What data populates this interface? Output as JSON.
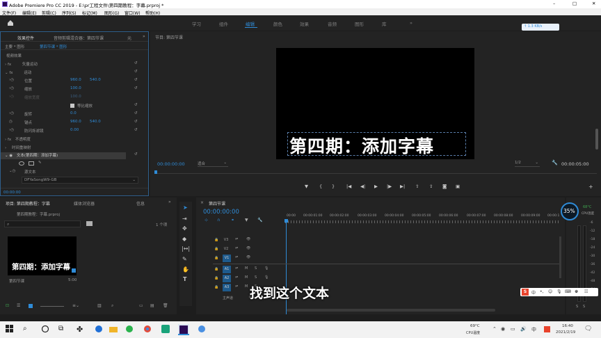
{
  "titlebar": {
    "title": "Adobe Premiere Pro CC 2019 - E:\\pr工程文件\\第四期教程：字幕.prproj *",
    "minimize": "–",
    "maximize": "□",
    "close": "✕"
  },
  "menu": [
    "文件(F)",
    "编辑(E)",
    "剪辑(C)",
    "序列(S)",
    "标记(M)",
    "图形(G)",
    "窗口(W)",
    "帮助(H)"
  ],
  "workspaces": [
    "学习",
    "组件",
    "编辑",
    "颜色",
    "效果",
    "音频",
    "图形",
    "库"
  ],
  "workspace_active": "编辑",
  "netspeed": "↑ 1.3 KB/s",
  "effect_controls": {
    "tabs": [
      "效果控件",
      "音频剪辑混合器：第四节课",
      "元"
    ],
    "breadcrumb_main": "主要 * 图形",
    "breadcrumb_seq": "第四节课 * 图形",
    "video_section": "视频效果",
    "rows": [
      {
        "label": "矢量运动"
      },
      {
        "label": "运动"
      },
      {
        "label": "位置",
        "v1": "960.0",
        "v2": "540.0"
      },
      {
        "label": "缩放",
        "v1": "100.0"
      },
      {
        "label": "缩放宽度",
        "v1": "100.0"
      },
      {
        "label": "等比缩放"
      },
      {
        "label": "旋转",
        "v1": "0.0"
      },
      {
        "label": "锚点",
        "v1": "960.0",
        "v2": "540.0"
      },
      {
        "label": "防闪烁滤镜",
        "v1": "0.00"
      },
      {
        "label": "不透明度"
      },
      {
        "label": "时间重映射"
      },
      {
        "label": "文本(第四期：添加字幕)"
      },
      {
        "label": "源文本"
      }
    ],
    "font": "DFYaSongW9-GB",
    "timecode": "00:00:00"
  },
  "program": {
    "title": "节目: 第四节课",
    "caption": "第四期：添加字幕",
    "timecode": "00:00:00:00",
    "fit": "适合",
    "ratio": "1/2",
    "duration": "00:00:05:00"
  },
  "project": {
    "tabs": [
      "项目: 第四期教程：字幕",
      "媒体浏览器",
      "信息"
    ],
    "file": "第四期教程：字幕.prproj",
    "count": "1 个项",
    "thumb_caption": "第四期：添加字幕",
    "item_name": "第四节课",
    "item_dur": "5:00"
  },
  "timeline": {
    "tab": "第四节课",
    "timecode": "00:00:00:00",
    "ruler": [
      "00:00",
      "00:00:01:00",
      "00:00:02:00",
      "00:00:03:00",
      "00:00:04:00",
      "00:00:05:00",
      "00:00:06:00",
      "00:00:07:00",
      "00:00:08:00",
      "00:00:09:00",
      "00:00:1"
    ],
    "tracks": [
      "V3",
      "V2",
      "V1",
      "A1",
      "A2",
      "A3"
    ],
    "master": "主声道",
    "master_val": "0.0"
  },
  "meter": {
    "percent": "35%",
    "temp": "68°C",
    "temp_label": "CPU温度"
  },
  "meter_scale": [
    "-6",
    "-12",
    "-18",
    "-24",
    "-30",
    "-36",
    "-42",
    "-48",
    "-54"
  ],
  "subtitle": "找到这个文本",
  "taskbar": {
    "temp": "69°C",
    "temp_label": "CPU温度",
    "time": "16:40",
    "date": "2021/2/19"
  },
  "colors": {
    "accent": "#2f8cd8",
    "bg": "#232323",
    "highlight": "#1e5a8c"
  }
}
